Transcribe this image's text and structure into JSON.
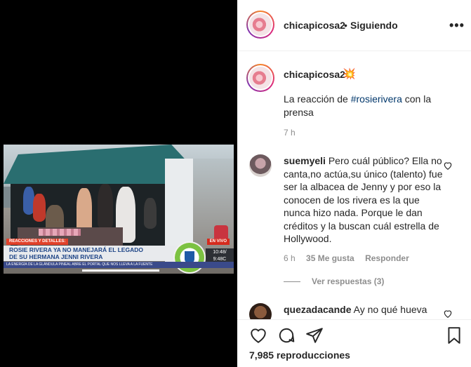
{
  "post": {
    "username": "chicapicosa2",
    "separator": "•",
    "follow_status": "Siguiendo",
    "more": "•••"
  },
  "video": {
    "tag": "REACCIONES Y DETALLES:",
    "live": "EN VIVO",
    "headline_line1": "ROSIE RIVERA YA NO MANEJARÁ EL LEGADO",
    "headline_line2": "DE SU HERMANA JENNI RIVERA",
    "time_line1": "10:48/",
    "time_line2": "9:48C",
    "ticker": "LA ENERGÍA DE LA GLÁNDULA PINEAL ABRE EL PORTAL QUE NOS LLEVA A LA FUENTE"
  },
  "caption": {
    "username": "chicapicosa2",
    "emoji": "💥",
    "text_before": "La reacción de ",
    "hashtag": "#rosierivera",
    "text_after": " con la prensa",
    "time": "7 h"
  },
  "comments": [
    {
      "username": "suemyeli",
      "text": "Pero cuál público? Ella no canta,no actúa,su único (talento) fue ser la albacea de Jenny y por eso la conocen de los rivera es la que nunca hizo nada. Porque le dan créditos y la buscan cuál estrella de Hollywood.",
      "time": "6 h",
      "likes": "35 Me gusta",
      "reply": "Responder",
      "view_replies": "Ver respuestas (3)"
    },
    {
      "username": "quezadacande",
      "text": "Ay no qué hueva"
    }
  ],
  "footer": {
    "views": "7,985 reproducciones"
  },
  "icons": {
    "like": "heart-icon",
    "comment": "comment-icon",
    "share": "share-icon",
    "save": "bookmark-icon"
  },
  "colors": {
    "hashtag": "#00376b",
    "muted": "#8e8e8e",
    "text": "#262626"
  }
}
